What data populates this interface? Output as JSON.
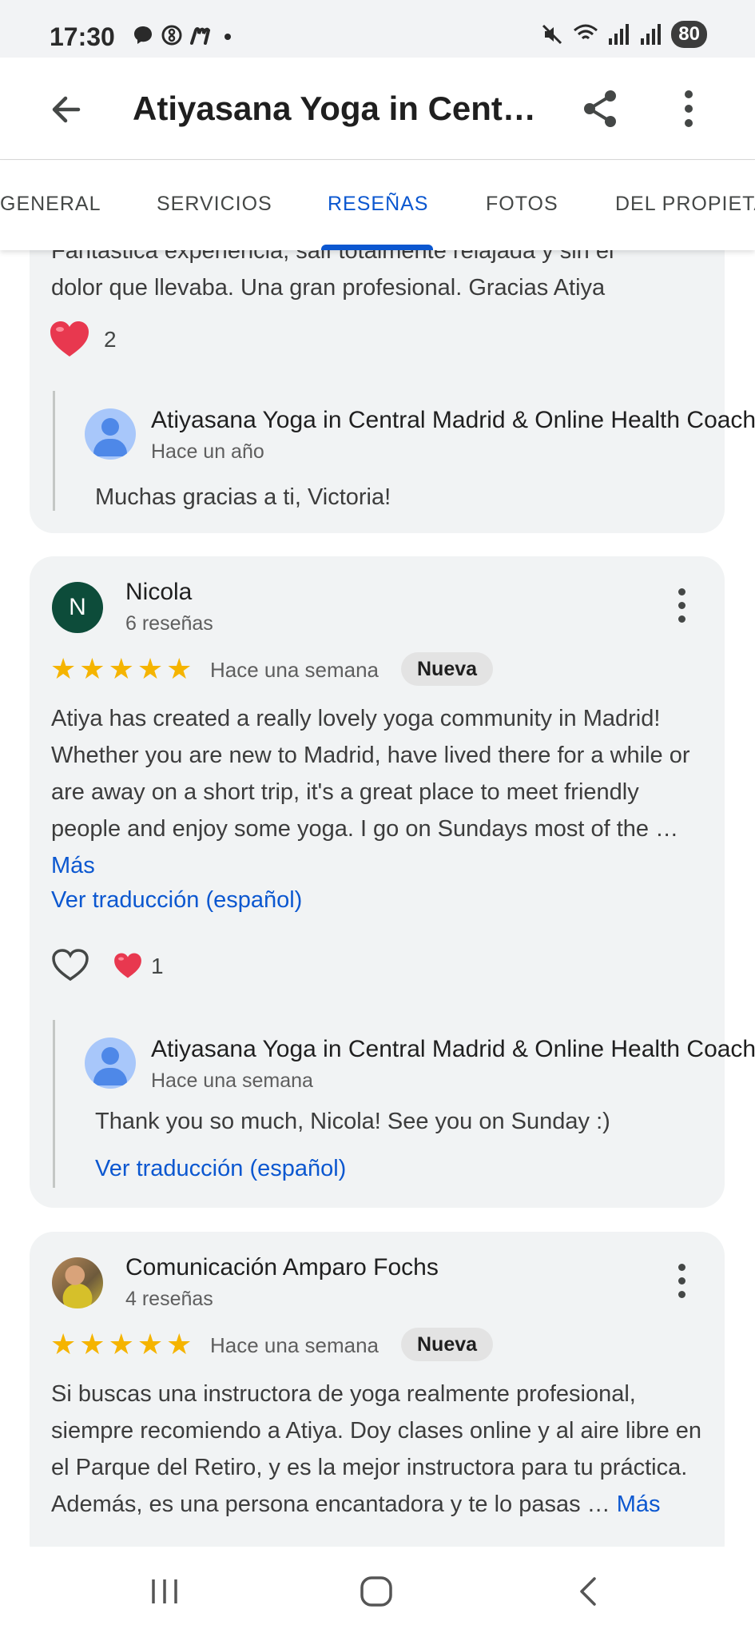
{
  "status_bar": {
    "time": "17:30",
    "battery": "80"
  },
  "header": {
    "title": "Atiyasana Yoga in Cent…",
    "back_icon": "arrow-back-icon",
    "share_icon": "share-icon",
    "more_icon": "more-vert-icon"
  },
  "tabs": [
    {
      "label": "GENERAL"
    },
    {
      "label": "SERVICIOS"
    },
    {
      "label": "RESEÑAS",
      "active": true
    },
    {
      "label": "FOTOS"
    },
    {
      "label": "DEL PROPIETA"
    }
  ],
  "review_prev": {
    "text_line1": "Fantástica experiencia, salí totalmente relajada y sin el",
    "text_line2": "dolor que llevaba. Una gran profesional. Gracias Atiya",
    "likes": "2",
    "reply": {
      "owner": "Atiyasana Yoga in Central Madrid & Online Health Coach",
      "time": "Hace un año",
      "text": "Muchas gracias a ti, Victoria!"
    }
  },
  "review_nicola": {
    "initial": "N",
    "name": "Nicola",
    "count": "6 reseñas",
    "rating": 5,
    "date": "Hace una semana",
    "badge": "Nueva",
    "text": "Atiya has created a really lovely yoga community in Madrid! Whether you are new to Madrid, have lived there for a while or are away on a short trip, it's a great place to meet friendly people and enjoy some yoga. I go on Sundays most of the … ",
    "more": "Más",
    "translate": "Ver traducción (español)",
    "likes": "1",
    "reply": {
      "owner": "Atiyasana Yoga in Central Madrid & Online Health Coach",
      "time": "Hace una semana",
      "text": "Thank you so much, Nicola! See you on Sunday :)",
      "translate": "Ver traducción (español)"
    }
  },
  "review_amparo": {
    "name": "Comunicación Amparo Fochs",
    "count": "4 reseñas",
    "rating": 5,
    "date": "Hace una semana",
    "badge": "Nueva",
    "text": "Si buscas una instructora de yoga realmente profesional, siempre recomiendo a Atiya. Doy clases online y al aire libre en el Parque del Retiro, y es la mejor instructora para tu práctica. Además, es una persona encantadora y te lo pasas … ",
    "more": "Más"
  },
  "colors": {
    "accent": "#0b57d0",
    "star": "#f5b400",
    "heart": "#e8384f",
    "card_bg": "#f1f3f4"
  }
}
